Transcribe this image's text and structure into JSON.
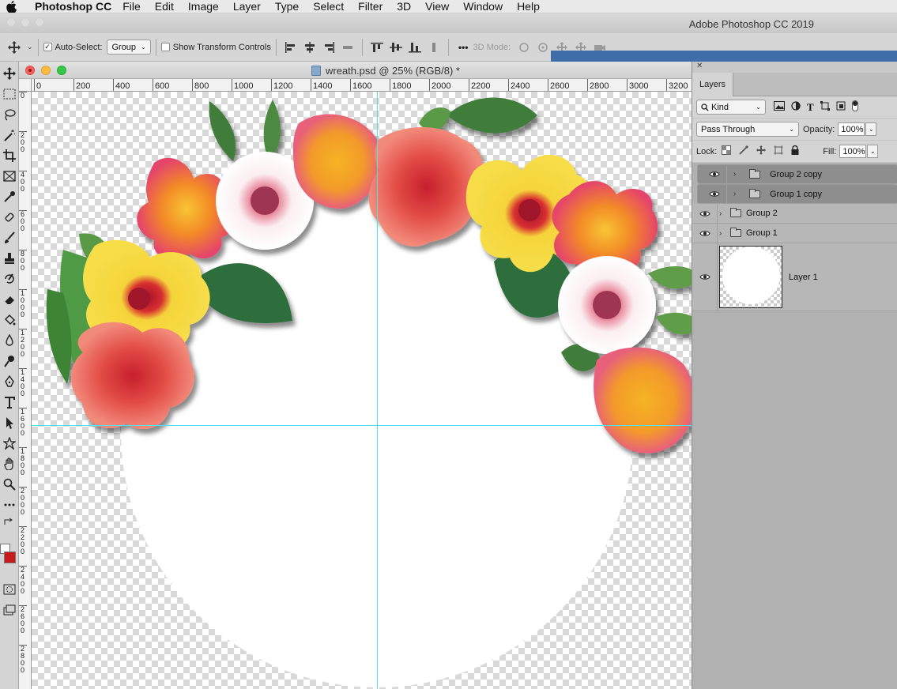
{
  "menubar": {
    "app_name": "Photoshop CC",
    "items": [
      "File",
      "Edit",
      "Image",
      "Layer",
      "Type",
      "Select",
      "Filter",
      "3D",
      "View",
      "Window",
      "Help"
    ]
  },
  "app_title": "Adobe Photoshop CC 2019",
  "options": {
    "auto_select_label": "Auto-Select:",
    "auto_select_value": "Group",
    "show_transform_label": "Show Transform Controls",
    "mode_3d_label": "3D Mode:",
    "more_label": "•••"
  },
  "document": {
    "title": "wreath.psd @ 25% (RGB/8) *",
    "ruler_h": [
      "0",
      "200",
      "400",
      "600",
      "800",
      "1000",
      "1200",
      "1400",
      "1600",
      "1800",
      "2000",
      "2200",
      "2400",
      "2600",
      "2800",
      "3000",
      "3200"
    ],
    "ruler_v": [
      "0",
      "2 0 0",
      "4 0 0",
      "6 0 0",
      "8 0 0",
      "1 0 0 0",
      "1 2 0 0",
      "1 4 0 0",
      "1 6 0 0",
      "1 8 0 0",
      "2 0 0 0",
      "2 2 0 0",
      "2 4 0 0",
      "2 6 0 0",
      "2 8 0 0"
    ]
  },
  "layers_panel": {
    "tab": "Layers",
    "filter_kind": "Kind",
    "blend_mode": "Pass Through",
    "opacity_label": "Opacity:",
    "opacity_value": "100%",
    "lock_label": "Lock:",
    "fill_label": "Fill:",
    "fill_value": "100%",
    "layers": [
      {
        "name": "Group 2 copy",
        "type": "group",
        "selected": true
      },
      {
        "name": "Group 1 copy",
        "type": "group",
        "selected": true
      },
      {
        "name": "Group 2",
        "type": "group",
        "selected": false
      },
      {
        "name": "Group 1",
        "type": "group",
        "selected": false
      },
      {
        "name": "Layer 1",
        "type": "pixel",
        "selected": false
      }
    ]
  },
  "colors": {
    "foreground": "#c8191d",
    "background": "#ffffff",
    "guide": "#4fe0e8"
  }
}
